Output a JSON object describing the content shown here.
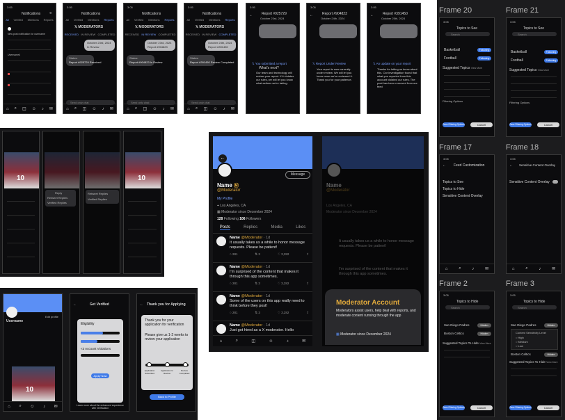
{
  "notif_screens": [
    {
      "time": "3:05",
      "title": "Notifications",
      "tabs": [
        "All",
        "Verified",
        "Mentions",
        "Reports"
      ],
      "active_tab": 0,
      "row_user": "Username4",
      "row_text": "New post notification for username"
    },
    {
      "time": "3:05",
      "title": "Notifications",
      "tabs": [
        "All",
        "Verified",
        "Mentions",
        "Reports"
      ],
      "active_tab": 3,
      "sub_tabs": [
        "RECEIVED",
        "IN REVIEW",
        "COMPLETED"
      ],
      "brand": "MODERATORS",
      "report_date": "October 23rd, 2024",
      "report_id": "Report #925729",
      "report_status": "Report #925729 Received",
      "status_label": "Status:",
      "in_label": "In Review"
    },
    {
      "time": "3:05",
      "title": "Notifications",
      "tabs": [
        "All",
        "Verified",
        "Mentions",
        "Reports"
      ],
      "active_tab": 3,
      "sub_tabs": [
        "RECEIVED",
        "IN REVIEW",
        "COMPLETED"
      ],
      "brand": "MODERATORS",
      "report_date": "October 23rd, 2024",
      "report_id": "Report #904823",
      "report_status": "Report #904823 In Review",
      "status_label": "Status:"
    },
    {
      "time": "3:05",
      "title": "Notifications",
      "tabs": [
        "All",
        "Verified",
        "Mentions",
        "Reports"
      ],
      "active_tab": 3,
      "sub_tabs": [
        "RECEIVED",
        "IN REVIEW",
        "COMPLETED"
      ],
      "brand": "MODERATORS",
      "report_date": "October 24th, 2024",
      "report_id": "Report #391450",
      "report_status": "Report #391450 Review Completed",
      "status_label": "Status:"
    }
  ],
  "report_detail_screens": [
    {
      "time": "3:05",
      "report_id": "Report #925729",
      "report_date": "October 23rd, 2024",
      "headline": "You submitted a report",
      "subhead": "What's next?",
      "body": "Our team and technology will review your report. If it violates our rules, we will let you know what actions we're taking."
    },
    {
      "time": "3:05",
      "report_id": "Report #904823",
      "report_date": "October 24th, 2024",
      "headline": "Report Under Review",
      "body": "Your report is now currently under review. We will let you know once we've reviewed it. Thank you for your patience."
    },
    {
      "time": "3:05",
      "report_id": "Report #391450",
      "report_date": "October 25th, 2024",
      "headline": "An update on your report",
      "body": "Thanks for letting us know about this. Our investigation found that what you reported from this account violated our rules. The post has been removed from our feed"
    }
  ],
  "chat_placeholder": "Send only chat",
  "profile_main": {
    "name": "Name",
    "handle": "@Moderator",
    "message_btn": "Message",
    "my_profile": "My Profile",
    "location": "Los Angeles, CA",
    "mod_since": "Moderator since December 2024",
    "following_count": "128",
    "following_label": "Following",
    "followers_count": "106",
    "followers_label": "Followers",
    "tabs": [
      "Posts",
      "Replies",
      "Media",
      "Likes"
    ],
    "posts": [
      {
        "name": "Name",
        "handle": "@Moderator",
        "time": "· 1d",
        "text": "It usually takes us a while to honor message requests. Please be patient!",
        "replies": "281",
        "reposts": "3",
        "likes": "3,282"
      },
      {
        "name": "Name",
        "handle": "@Moderator",
        "time": "· 1d",
        "text": "I'm surprised of the content that makes it through this app sometimes.",
        "replies": "281",
        "reposts": "3",
        "likes": "3,282"
      },
      {
        "name": "Name",
        "handle": "@Moderator",
        "time": "· 1d",
        "text": "Some of the users on this app really need to think before they post!",
        "replies": "281",
        "reposts": "3",
        "likes": "3,282"
      },
      {
        "name": "Name",
        "handle": "@Moderator",
        "time": "· 1d",
        "text": "Just got hired as a X moderator. Hello",
        "replies": "",
        "reposts": "",
        "likes": ""
      }
    ]
  },
  "moderator_overlay": {
    "title": "Moderator Account",
    "body": "Moderators assist users, help deal with reports, and moderate content running through the app",
    "since": "Moderator since December 2024"
  },
  "verify_screens": {
    "username": "Username",
    "get_verified": "Get Verified",
    "edit_profile": "Edit profile",
    "eligibility": "Eligibility",
    "violations": "<3 Account Violations",
    "apply": "Apply Now",
    "learn_more": "Learn more about the enhanced experience with Verification",
    "thank_title": "Thank you for Applying",
    "thank_body": "Thank you for your application for verification",
    "thank_wait": "Please give us 1-2 weeks to review your application",
    "steps": [
      "Application Submitted",
      "Application In Review",
      "Review Completed"
    ],
    "back_btn": "Back to Profile"
  },
  "feed_menu": {
    "options": [
      "Reply",
      "Retweet Replies",
      "Verified Replies"
    ]
  },
  "frames": [
    {
      "label": "Frame 20",
      "title": "Topics to See",
      "search": "Search",
      "items": [
        "Basketball",
        "Football"
      ],
      "toggle": "Following",
      "suggested": "Suggested Topics",
      "view_more": "View More",
      "filtering": "Filtering Options",
      "buttons": [
        "Save Filtering Options",
        "Cancel"
      ]
    },
    {
      "label": "Frame 21",
      "title": "Topics to See",
      "search": "Search",
      "items": [
        "Basketball",
        "Football"
      ],
      "toggle": "Following",
      "suggested": "Suggested Topics",
      "view_more": "View More",
      "filtering": "Filtering Options",
      "buttons": [
        "Save Filtering Options",
        "Cancel"
      ]
    },
    {
      "label": "Frame 17",
      "title": "Feed Customization",
      "items": [
        "Topics to See",
        "Topics to Hide",
        "Sensitive Content Overlay"
      ]
    },
    {
      "label": "Frame 18",
      "title": "Sensitive Content Overlay",
      "items": [
        "Sensitive Content Overlay"
      ]
    },
    {
      "label": "Frame 2",
      "title": "Topics to Hide",
      "search": "Search",
      "items": [
        "San Diego Padres",
        "Boston Celtics"
      ],
      "toggle": "Hidden",
      "suggested": "Suggested Topics To Hide",
      "view_more": "View More",
      "buttons": [
        "Save Filtering Options",
        "Cancel"
      ]
    },
    {
      "label": "Frame 3",
      "title": "Topics to Hide",
      "search": "Search",
      "items": [
        "San Diego Padres",
        "Boston Celtics"
      ],
      "toggle": "Hidden",
      "sensitivity": "Content Sensitivity Level",
      "levels": [
        "High",
        "Medium",
        "Low"
      ],
      "suggested": "Suggested Topics To Hide",
      "view_more": "View More",
      "buttons": [
        "Save Filtering Options",
        "Cancel"
      ]
    }
  ],
  "colors": {
    "accent": "#3f7ae8",
    "banner": "#5b8ff5",
    "gold": "#e0a93b",
    "dark": "#0c0c0e"
  }
}
